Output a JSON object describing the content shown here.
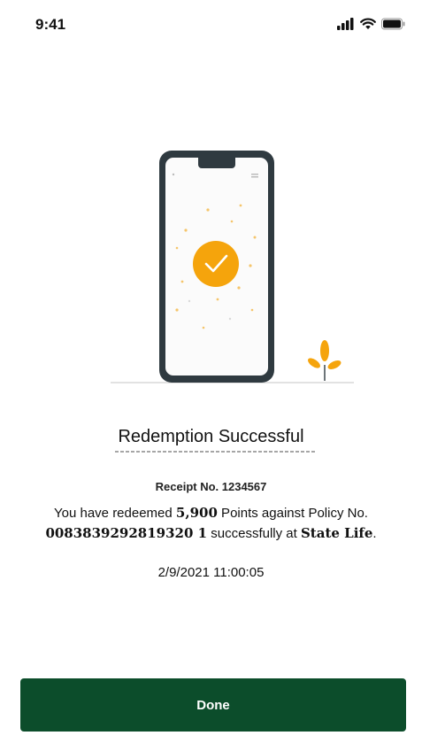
{
  "status_bar": {
    "time": "9:41",
    "icons": [
      "signal-icon",
      "wifi-icon",
      "battery-icon"
    ]
  },
  "illustration": {
    "accent_color": "#f5a40c",
    "phone_frame_color": "#2f3a40",
    "plant_color": "#f5a40c"
  },
  "result": {
    "title": "Redemption Successful",
    "receipt_label": "Receipt No. 1234567",
    "message_prefix": "You have redeemed ",
    "points": "5,900",
    "message_mid": " Points against Policy No. ",
    "policy_number": "0083839292819320 1",
    "message_mid2": " successfully at ",
    "company": "State Life",
    "message_suffix": ".",
    "datetime": "2/9/2021 11:00:05"
  },
  "actions": {
    "done_label": "Done",
    "done_color": "#0c4d2b"
  }
}
